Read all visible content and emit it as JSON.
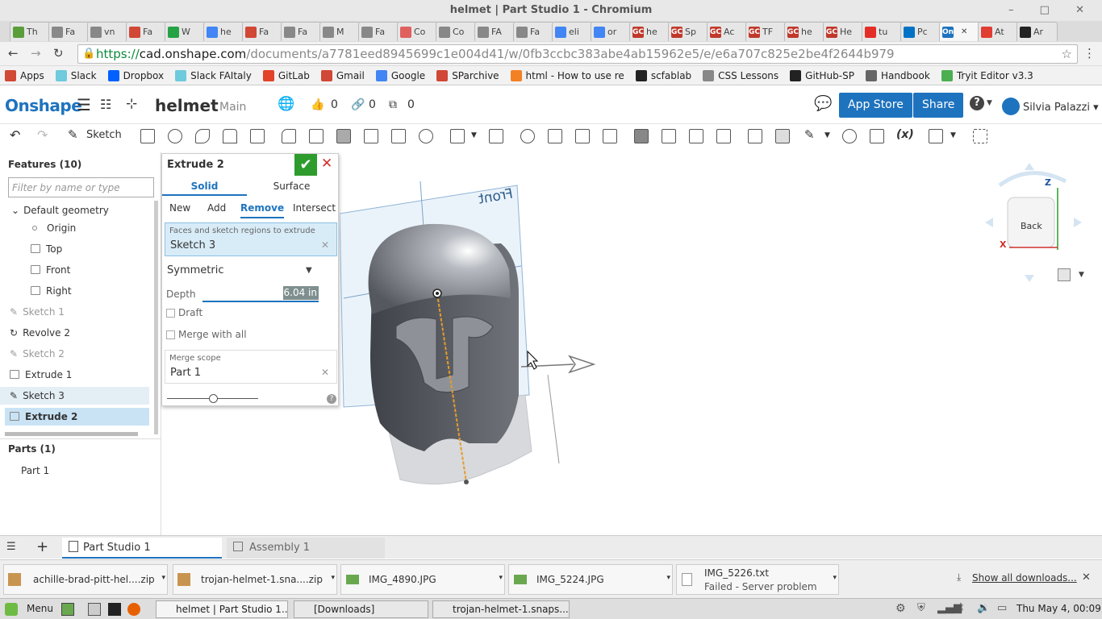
{
  "window": {
    "title": "helmet | Part Studio 1 - Chromium"
  },
  "browser_tabs": [
    {
      "label": "Th",
      "color": "#5a9e3a"
    },
    {
      "label": "Fa",
      "color": "#888888"
    },
    {
      "label": "vn",
      "color": "#888888"
    },
    {
      "label": "Fa",
      "color": "#d14836"
    },
    {
      "label": "W",
      "color": "#25a244"
    },
    {
      "label": "he",
      "color": "#4285f4"
    },
    {
      "label": "Fa",
      "color": "#d14836"
    },
    {
      "label": "Fa",
      "color": "#888888"
    },
    {
      "label": "M",
      "color": "#888888"
    },
    {
      "label": "Fa",
      "color": "#888888"
    },
    {
      "label": "Co",
      "color": "#e06060"
    },
    {
      "label": "Co",
      "color": "#888888"
    },
    {
      "label": "FA",
      "color": "#888888"
    },
    {
      "label": "Fa",
      "color": "#888888"
    },
    {
      "label": "eli",
      "color": "#4285f4"
    },
    {
      "label": "or",
      "color": "#4285f4"
    },
    {
      "label": "he",
      "color": "#c0392b",
      "prefix": "GC"
    },
    {
      "label": "Sp",
      "color": "#c0392b",
      "prefix": "GC"
    },
    {
      "label": "Ac",
      "color": "#c0392b",
      "prefix": "GC"
    },
    {
      "label": "TF",
      "color": "#c0392b",
      "prefix": "GC"
    },
    {
      "label": "he",
      "color": "#c0392b",
      "prefix": "GC"
    },
    {
      "label": "He",
      "color": "#c0392b",
      "prefix": "GC"
    },
    {
      "label": "tu",
      "color": "#e52d27"
    },
    {
      "label": "Pc",
      "color": "#0072c6"
    },
    {
      "label": "",
      "color": "#1e73be",
      "prefix": "On",
      "active": true
    },
    {
      "label": "At",
      "color": "#e03c31"
    },
    {
      "label": "Ar",
      "color": "#222222"
    }
  ],
  "omnibox": {
    "scheme": "https://",
    "host": "cad.onshape.com",
    "path": "/documents/a7781eed8945699c1e004d41/w/0fb3ccbc383abe4ab15962e5/e/e6a707c825e2be4f2644b979"
  },
  "bookmarks": [
    {
      "label": "Apps",
      "color": "#d14836"
    },
    {
      "label": "Slack",
      "color": "#6ecadc"
    },
    {
      "label": "Dropbox",
      "color": "#0061fe"
    },
    {
      "label": "Slack FAItaly",
      "color": "#6ecadc"
    },
    {
      "label": "GitLab",
      "color": "#e24329"
    },
    {
      "label": "Gmail",
      "color": "#d14836"
    },
    {
      "label": "Google",
      "color": "#4285f4"
    },
    {
      "label": "SParchive",
      "color": "#d14836"
    },
    {
      "label": "html - How to use re",
      "color": "#f48024"
    },
    {
      "label": "scfablab",
      "color": "#222222"
    },
    {
      "label": "CSS Lessons",
      "color": "#888888"
    },
    {
      "label": "GitHub-SP",
      "color": "#222222"
    },
    {
      "label": "Handbook",
      "color": "#666666"
    },
    {
      "label": "Tryit Editor v3.3",
      "color": "#4caf50"
    }
  ],
  "onshape": {
    "logo": "Onshape",
    "doc_name": "helmet",
    "branch": "Main",
    "likes": "0",
    "links": "0",
    "copies": "0",
    "app_store": "App Store",
    "share": "Share",
    "help": "?",
    "user": "Silvia Palazzi",
    "sketch_label": "Sketch",
    "formula_label": "(x)"
  },
  "features": {
    "header": "Features (10)",
    "filter_placeholder": "Filter by name or type",
    "default_geometry": "Default geometry",
    "items": [
      {
        "label": "Origin"
      },
      {
        "label": "Top"
      },
      {
        "label": "Front"
      },
      {
        "label": "Right"
      },
      {
        "label": "Sketch 1"
      },
      {
        "label": "Revolve 2"
      },
      {
        "label": "Sketch 2"
      },
      {
        "label": "Extrude 1"
      },
      {
        "label": "Sketch 3"
      },
      {
        "label": "Extrude 2"
      }
    ],
    "parts_header": "Parts (1)",
    "parts": [
      "Part 1"
    ]
  },
  "dialog": {
    "title": "Extrude 2",
    "solid": "Solid",
    "surface": "Surface",
    "ops": [
      "New",
      "Add",
      "Remove",
      "Intersect"
    ],
    "faces_label": "Faces and sketch regions to extrude",
    "faces_value": "Sketch 3",
    "end_type": "Symmetric",
    "depth_label": "Depth",
    "depth_value": "6.04 in",
    "draft": "Draft",
    "merge_all": "Merge with all",
    "merge_scope_label": "Merge scope",
    "merge_scope_value": "Part 1",
    "help": "?",
    "slider_fraction": 0.5
  },
  "viewport": {
    "plane_label": "Front",
    "view_cube_face": "Back",
    "axis_z": "Z",
    "axis_x": "X"
  },
  "bottom_tabs": [
    "Part Studio 1",
    "Assembly 1"
  ],
  "downloads": {
    "items": [
      {
        "name": "achille-brad-pitt-hel....zip"
      },
      {
        "name": "trojan-helmet-1.sna....zip"
      },
      {
        "name": "IMG_4890.JPG"
      },
      {
        "name": "IMG_5224.JPG"
      },
      {
        "name": "IMG_5226.txt",
        "status": "Failed - Server problem"
      }
    ],
    "show_all": "Show all downloads..."
  },
  "taskbar": {
    "menu": "Menu",
    "tasks": [
      "helmet | Part Studio 1...",
      "[Downloads]",
      "trojan-helmet-1.snaps..."
    ],
    "clock": "Thu May  4, 00:09"
  }
}
